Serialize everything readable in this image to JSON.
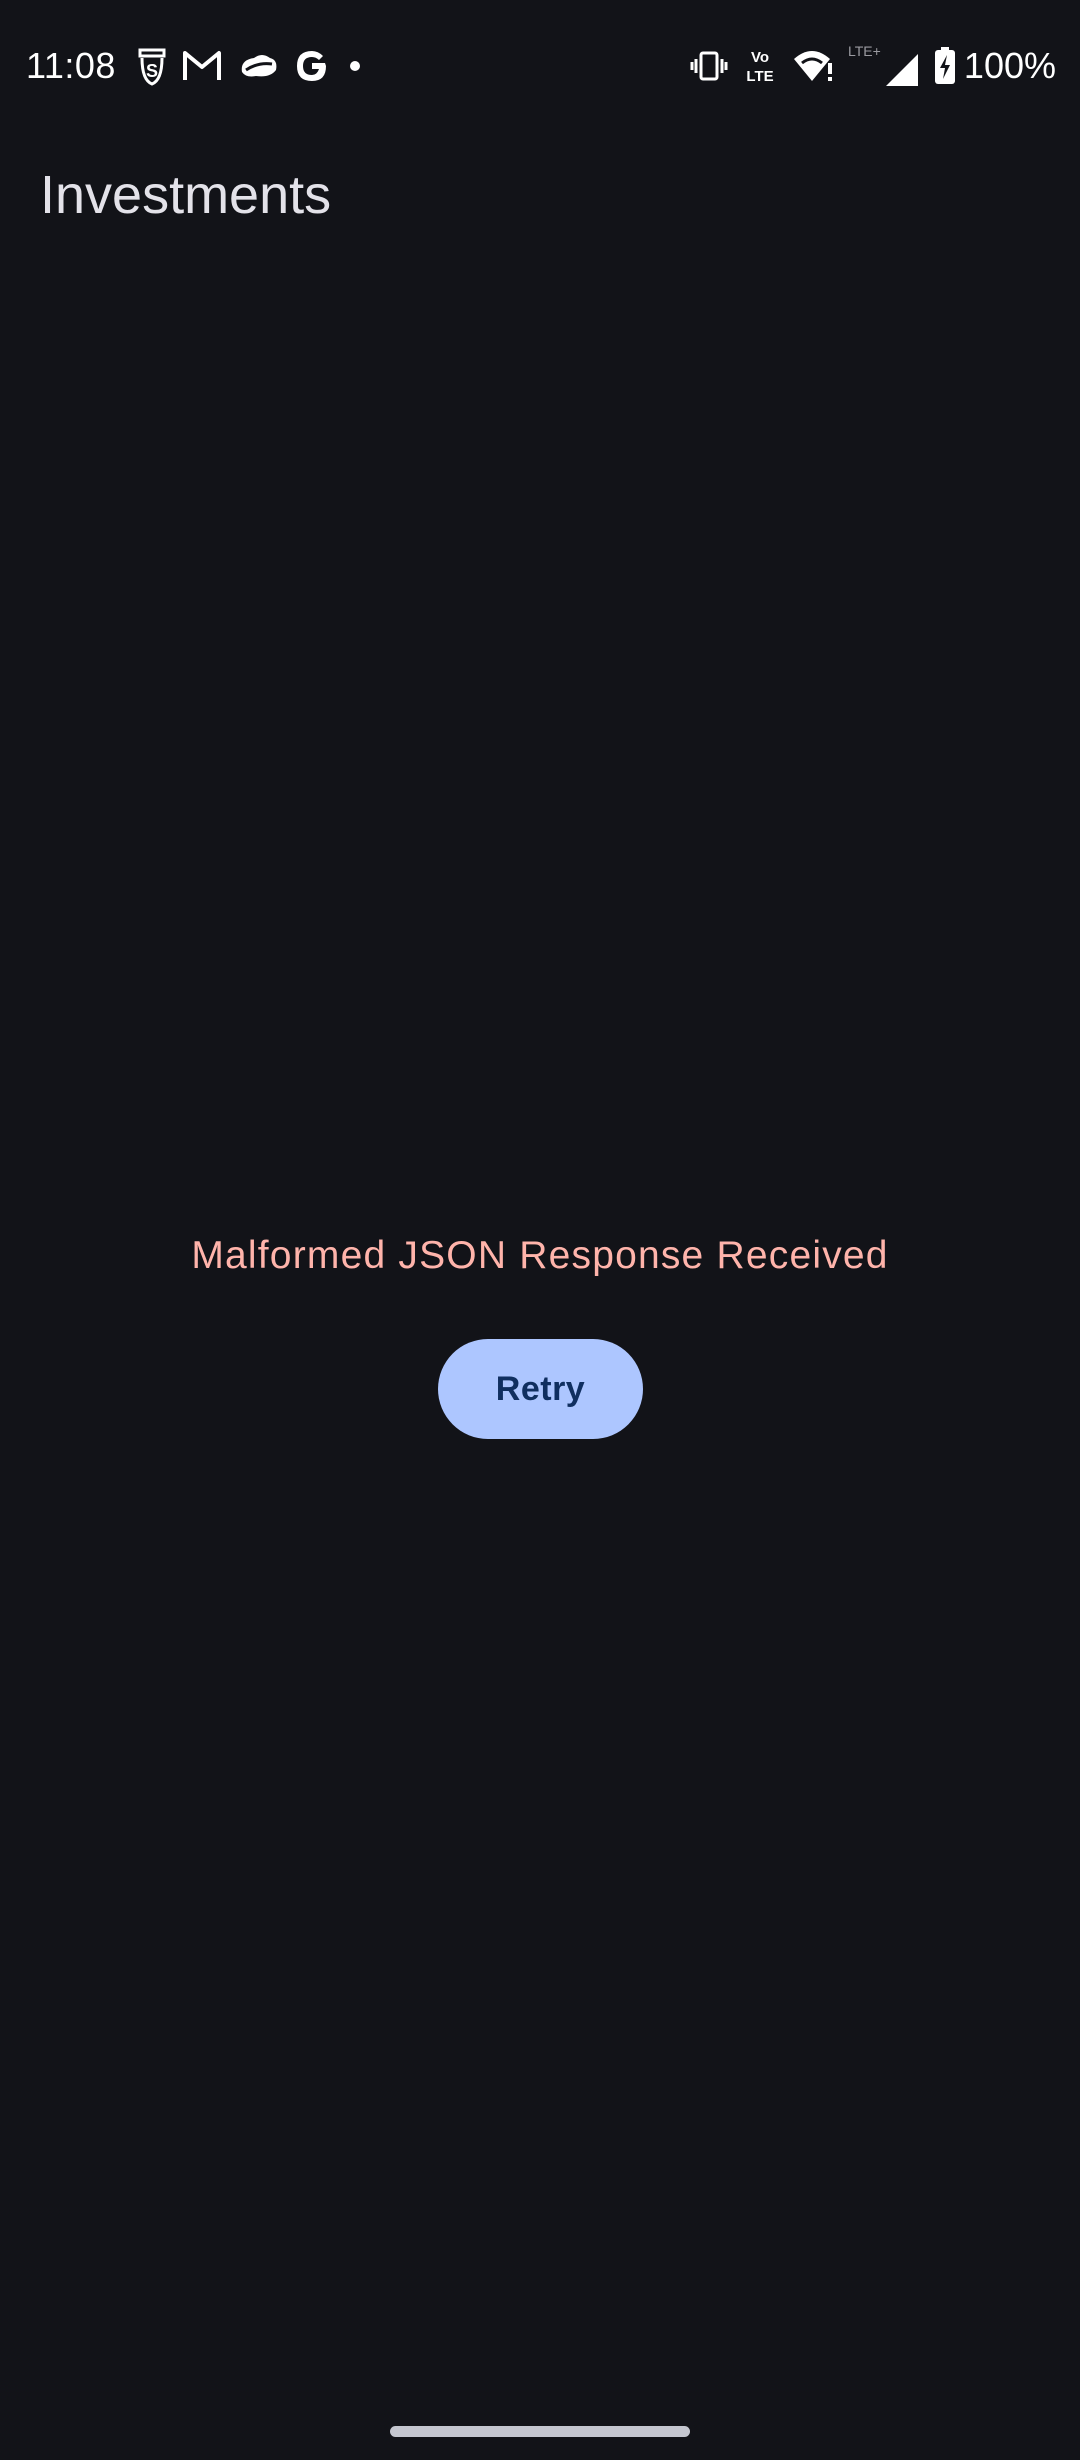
{
  "status_bar": {
    "time": "11:08",
    "battery_percent": "100%",
    "notification_icons": [
      "s-shield-icon",
      "gmail-icon",
      "cloud-bird-icon",
      "google-icon",
      "more-dot-icon"
    ],
    "system_icons": [
      "vibrate-icon",
      "volte-icon",
      "wifi-icon",
      "lte-signal-icon",
      "battery-charging-icon"
    ],
    "volte_label_top": "Vo",
    "volte_label_bottom": "LTE",
    "lte_label": "LTE+"
  },
  "app_bar": {
    "title": "Investments"
  },
  "error": {
    "message": "Malformed JSON Response Received",
    "retry_label": "Retry"
  },
  "colors": {
    "background": "#121318",
    "error_text": "#ffb4ab",
    "button_bg": "#adc6ff",
    "button_text": "#102f60"
  }
}
